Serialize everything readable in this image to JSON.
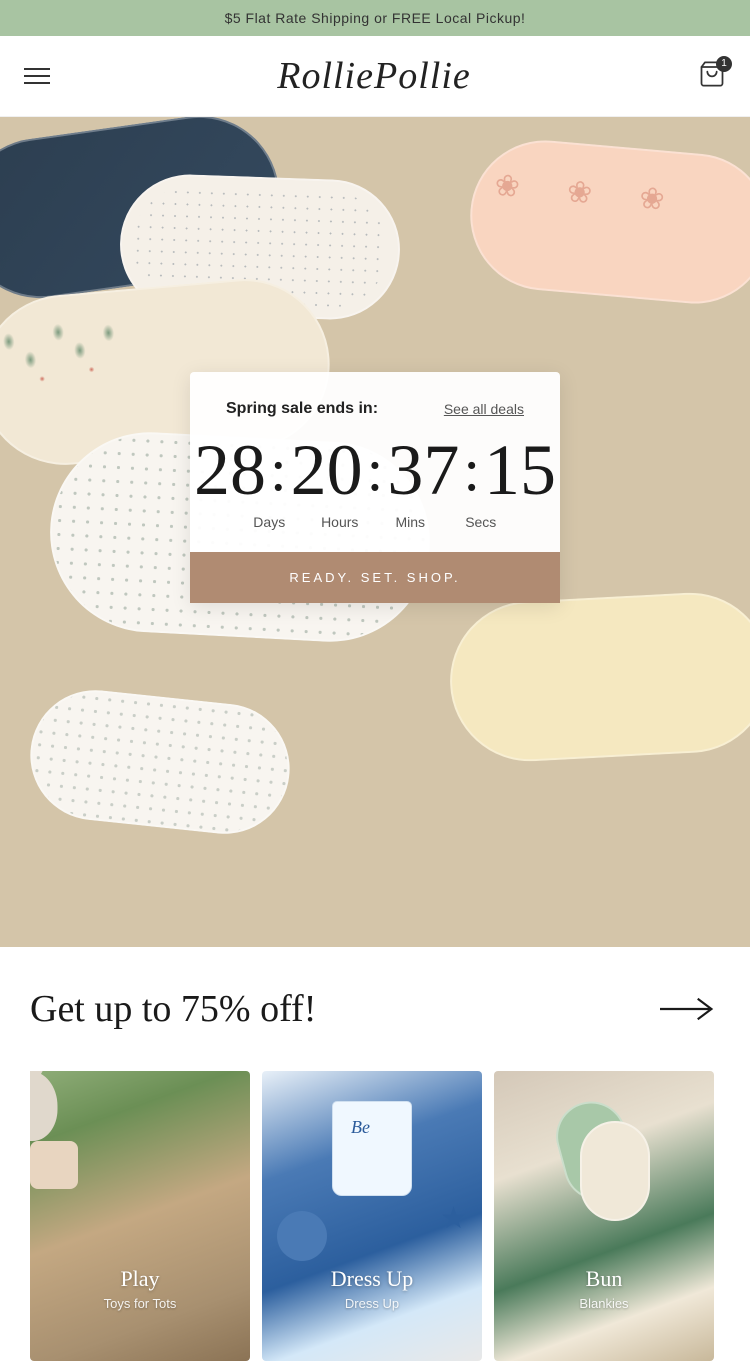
{
  "announcement": {
    "text": "$5 Flat Rate Shipping or FREE Local Pickup!"
  },
  "header": {
    "logo": "RolliePollie",
    "cart_count": "1"
  },
  "countdown": {
    "sale_label": "Spring sale ends in:",
    "see_deals": "See all deals",
    "days": "28",
    "hours": "20",
    "mins": "37",
    "secs": "15",
    "days_label": "Days",
    "hours_label": "Hours",
    "mins_label": "Mins",
    "secs_label": "Secs",
    "shop_btn": "READY. SET. SHOP."
  },
  "sale_section": {
    "headline": "Get up to 75% off!",
    "arrow": "→"
  },
  "categories": [
    {
      "id": "play",
      "title": "Play",
      "subtitle": "Toys for Tots",
      "bg_class": "cat-bg-play"
    },
    {
      "id": "dress-up",
      "title": "Dress Up",
      "subtitle": "Dress Up",
      "bg_class": "cat-bg-dress"
    },
    {
      "id": "blankies",
      "title": "Bun",
      "subtitle": "Blankies",
      "bg_class": "cat-bg-bun"
    }
  ]
}
